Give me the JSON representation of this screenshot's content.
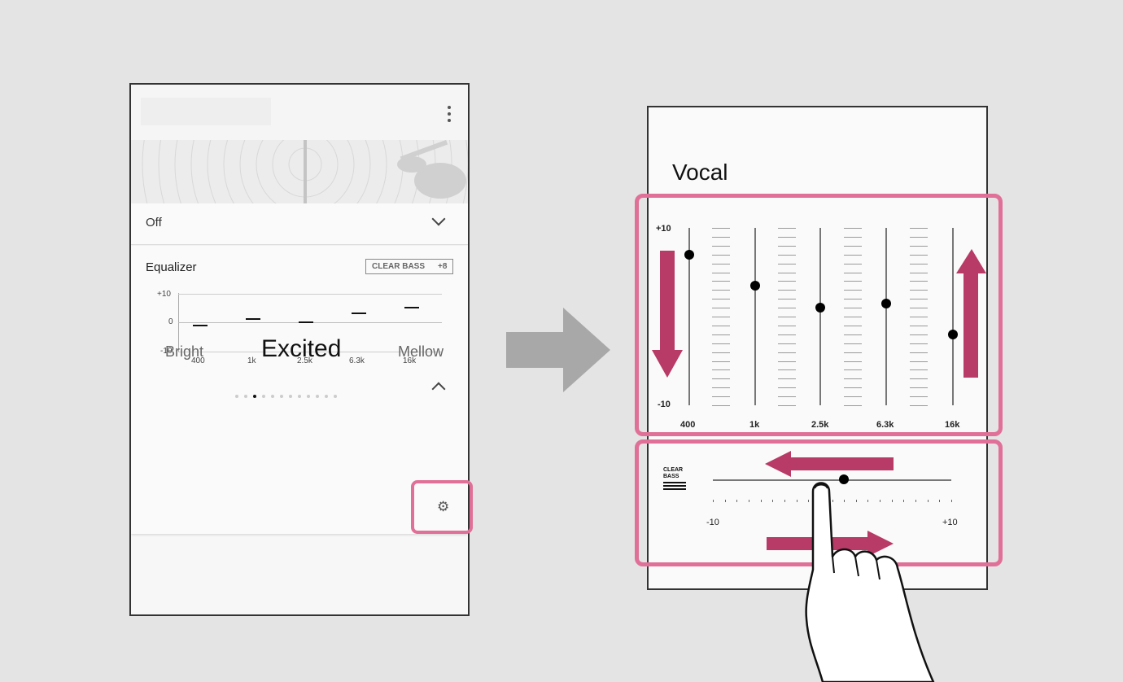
{
  "left_screen": {
    "surround_value": "Off",
    "equalizer": {
      "title": "Equalizer",
      "clear_bass_label": "CLEAR BASS",
      "clear_bass_value": "+8",
      "y_axis": [
        "+10",
        "0",
        "-10"
      ],
      "bands": [
        "400",
        "1k",
        "2.5k",
        "6.3k",
        "16k"
      ],
      "levels": [
        -1,
        1,
        0,
        3,
        5
      ]
    },
    "presets": {
      "prev": "Bright",
      "current": "Excited",
      "next": "Mellow",
      "page_count": 12,
      "active_page": 3
    }
  },
  "right_screen": {
    "preset_name": "Vocal",
    "equalizer": {
      "y_max_label": "+10",
      "y_min_label": "-10",
      "bands": [
        "400",
        "1k",
        "2.5k",
        "6.3k",
        "16k"
      ],
      "levels": [
        7,
        3.5,
        1,
        1.5,
        -2
      ]
    },
    "clear_bass": {
      "logo_line1": "CLEAR",
      "logo_line2": "BASS",
      "min_label": "-10",
      "max_label": "+10",
      "value": 1
    }
  },
  "colors": {
    "highlight": "#e07097",
    "guide_arrow": "#b83a66",
    "transition_arrow": "#a8a8a8"
  }
}
